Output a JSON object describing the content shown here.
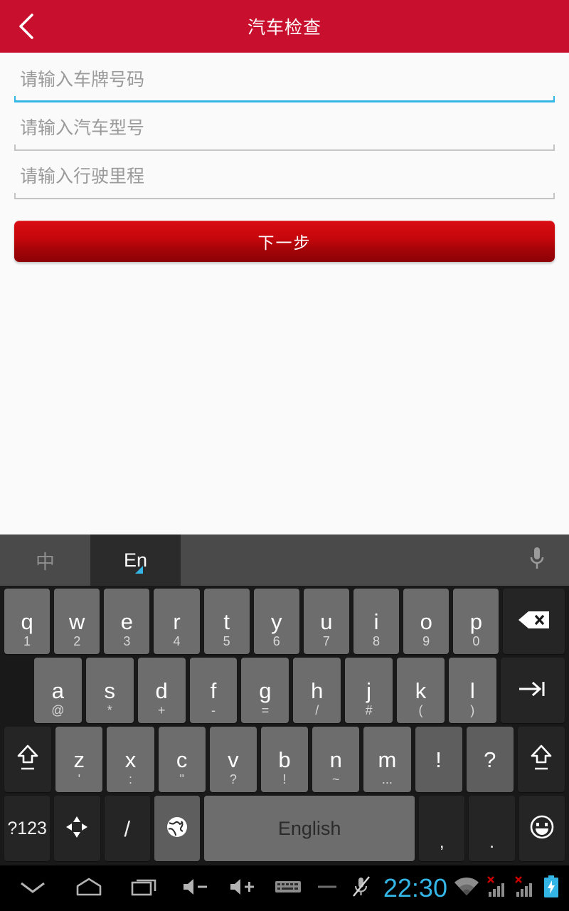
{
  "header": {
    "title": "汽车检查",
    "back_icon": "chevron-left-icon",
    "bg_color": "#c8102e"
  },
  "form": {
    "fields": [
      {
        "name": "plate-number",
        "placeholder": "请输入车牌号码",
        "value": "",
        "focused": true
      },
      {
        "name": "car-model",
        "placeholder": "请输入汽车型号",
        "value": "",
        "focused": false
      },
      {
        "name": "mileage",
        "placeholder": "请输入行驶里程",
        "value": "",
        "focused": false
      }
    ],
    "submit_label": "下一步",
    "focus_color": "#33b5e5"
  },
  "keyboard": {
    "toolbar": {
      "chinese_tab": "中",
      "english_tab": "En",
      "mic_icon": "microphone-icon",
      "active_tab": "En"
    },
    "row1": [
      {
        "main": "q",
        "sub": "1"
      },
      {
        "main": "w",
        "sub": "2"
      },
      {
        "main": "e",
        "sub": "3"
      },
      {
        "main": "r",
        "sub": "4"
      },
      {
        "main": "t",
        "sub": "5"
      },
      {
        "main": "y",
        "sub": "6"
      },
      {
        "main": "u",
        "sub": "7"
      },
      {
        "main": "i",
        "sub": "8"
      },
      {
        "main": "o",
        "sub": "9"
      },
      {
        "main": "p",
        "sub": "0"
      }
    ],
    "backspace_icon": "backspace-icon",
    "row2": [
      {
        "main": "a",
        "sub": "@"
      },
      {
        "main": "s",
        "sub": "*"
      },
      {
        "main": "d",
        "sub": "+"
      },
      {
        "main": "f",
        "sub": "-"
      },
      {
        "main": "g",
        "sub": "="
      },
      {
        "main": "h",
        "sub": "/"
      },
      {
        "main": "j",
        "sub": "#"
      },
      {
        "main": "k",
        "sub": "("
      },
      {
        "main": "l",
        "sub": ")"
      }
    ],
    "tab_icon": "tab-arrow-icon",
    "row3": [
      {
        "main": "z",
        "sub": "'"
      },
      {
        "main": "x",
        "sub": ":"
      },
      {
        "main": "c",
        "sub": "\""
      },
      {
        "main": "v",
        "sub": "?"
      },
      {
        "main": "b",
        "sub": "!"
      },
      {
        "main": "n",
        "sub": "~"
      },
      {
        "main": "m",
        "sub": "..."
      }
    ],
    "row3_extra": [
      {
        "main": "!"
      },
      {
        "main": "?"
      }
    ],
    "shift_icon": "shift-icon",
    "row4": {
      "symbols_label": "?123",
      "arrows_icon": "arrow-pad-icon",
      "slash_label": "/",
      "globe_icon": "globe-icon",
      "space_label": "English",
      "comma_label": ",",
      "period_label": ".",
      "emoji_icon": "emoji-smiley-icon"
    }
  },
  "navbar": {
    "hide_keyboard_icon": "chevron-down-icon",
    "home_icon": "home-icon",
    "recents_icon": "recents-icon",
    "volume_down_icon": "volume-down-icon",
    "volume_up_icon": "volume-up-icon",
    "keyboard_icon": "keyboard-icon",
    "dash_icon": "dash-icon",
    "mute_mic_icon": "mic-muted-icon",
    "clock": "22:30",
    "clock_color": "#33b5e5",
    "wifi_icon": "wifi-icon",
    "signal1_icon": "signal-no-service-icon",
    "signal2_icon": "signal-no-service-icon",
    "battery_icon": "battery-charging-icon"
  }
}
